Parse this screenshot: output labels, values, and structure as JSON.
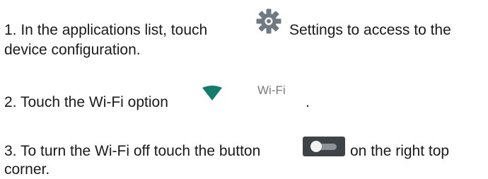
{
  "steps": [
    {
      "before": "1. In the applications list, touch",
      "after": "Settings to access to the",
      "continuation": "device configuration.",
      "icon": "settings-gear-icon"
    },
    {
      "before": "2. Touch the Wi-Fi option",
      "inline_label": "Wi-Fi",
      "after": ".",
      "icon": "wifi-triangle-icon"
    },
    {
      "before": "3. To turn the Wi-Fi off touch the button",
      "after": "on the right top",
      "continuation": "corner.",
      "icon": "toggle-switch-icon"
    }
  ],
  "colors": {
    "wifi_green": "#127d6c",
    "gear_gray": "#6f7a82",
    "toggle_track": "#3d4347"
  }
}
